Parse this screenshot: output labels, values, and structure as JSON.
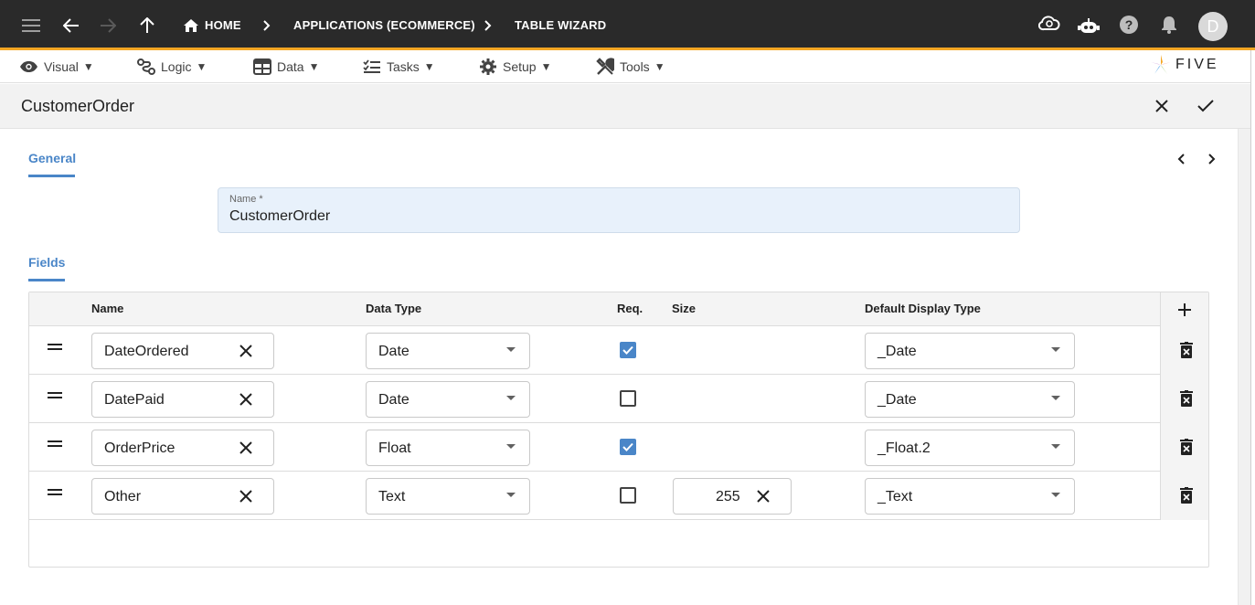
{
  "appbar": {
    "breadcrumbs": [
      "HOME",
      "APPLICATIONS (ECOMMERCE)",
      "TABLE WIZARD"
    ],
    "avatar_initial": "D"
  },
  "menu": [
    {
      "label": "Visual",
      "icon": "eye-icon"
    },
    {
      "label": "Logic",
      "icon": "logic-icon"
    },
    {
      "label": "Data",
      "icon": "table-icon"
    },
    {
      "label": "Tasks",
      "icon": "checklist-icon"
    },
    {
      "label": "Setup",
      "icon": "gear-icon"
    },
    {
      "label": "Tools",
      "icon": "tools-icon"
    }
  ],
  "menu_caret": "▼",
  "logo_text": "FIVE",
  "form": {
    "title": "CustomerOrder",
    "tab_general": "General",
    "tab_fields": "Fields",
    "name_label": "Name *",
    "name_value": "CustomerOrder"
  },
  "grid": {
    "headers": {
      "name": "Name",
      "data_type": "Data Type",
      "req": "Req.",
      "size": "Size",
      "display_type": "Default Display Type"
    },
    "rows": [
      {
        "name": "DateOrdered",
        "data_type": "Date",
        "required": true,
        "size": "",
        "display_type": "_Date"
      },
      {
        "name": "DatePaid",
        "data_type": "Date",
        "required": false,
        "size": "",
        "display_type": "_Date"
      },
      {
        "name": "OrderPrice",
        "data_type": "Float",
        "required": true,
        "size": "",
        "display_type": "_Float.2"
      },
      {
        "name": "Other",
        "data_type": "Text",
        "required": false,
        "size": "255",
        "display_type": "_Text"
      }
    ]
  },
  "colors": {
    "accent": "#4a86c8",
    "appbar": "#2a2a2a",
    "appbar_border": "#f5a623"
  }
}
